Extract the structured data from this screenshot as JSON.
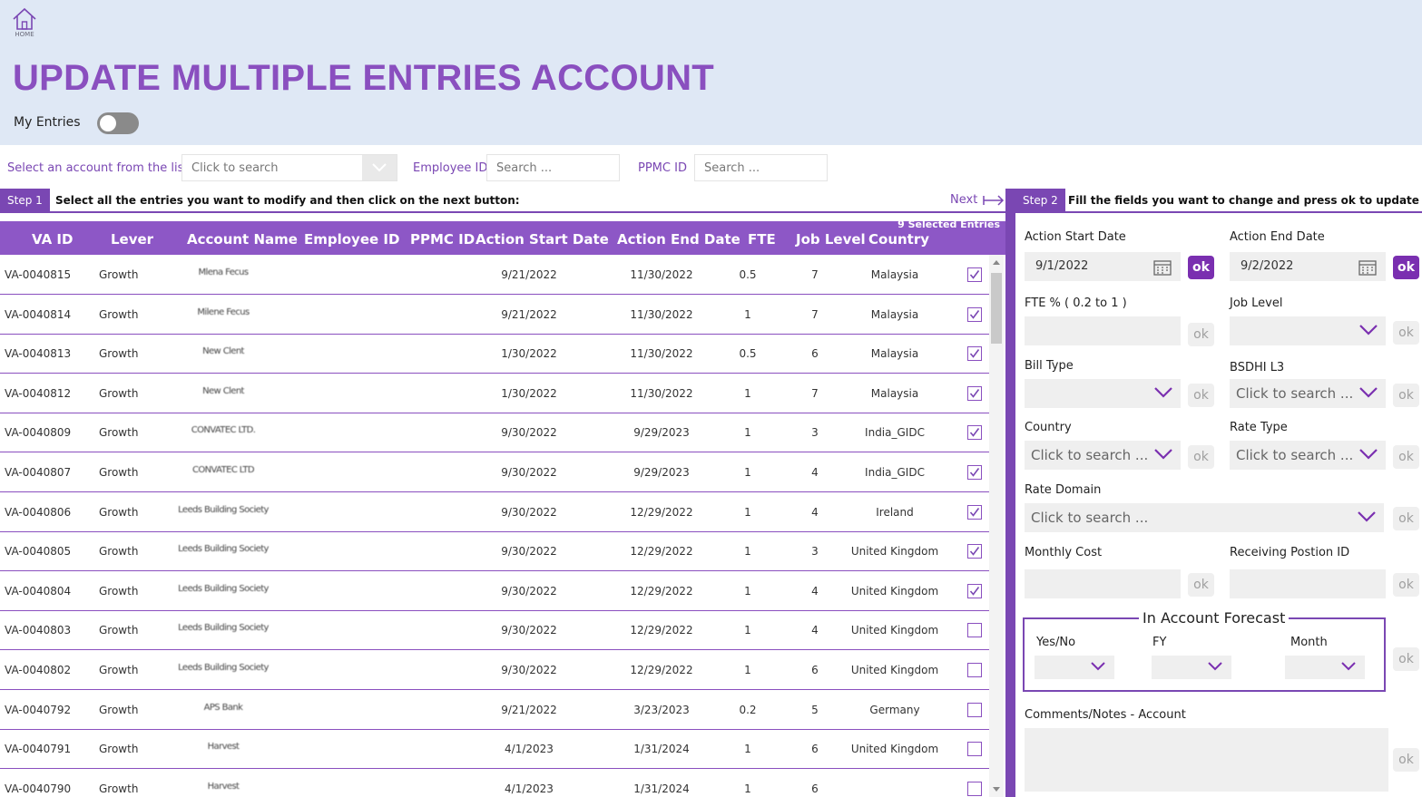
{
  "header": {
    "home_label": "HOME",
    "title": "UPDATE MULTIPLE ENTRIES ACCOUNT",
    "my_entries_label": "My Entries",
    "my_entries_on": false
  },
  "filters": {
    "account_label": "Select an account from the list",
    "account_placeholder": "Click to search",
    "employee_label": "Employee ID",
    "employee_placeholder": "Search ...",
    "ppmc_label": "PPMC ID",
    "ppmc_placeholder": "Search ..."
  },
  "step1": {
    "badge": "Step 1",
    "text": "Select all the entries you want to modify and then click on the next button:",
    "next_label": "Next",
    "selected_count": "9 Selected Entries"
  },
  "table": {
    "columns": [
      "VA ID",
      "Lever",
      "Account Name",
      "Employee ID",
      "PPMC ID",
      "Action Start Date",
      "Action End Date",
      "FTE",
      "Job Level",
      "Country"
    ],
    "rows": [
      {
        "va_id": "VA-0040815",
        "lever": "Growth",
        "account": "Mlena Fecus",
        "start": "9/21/2022",
        "end": "11/30/2022",
        "fte": "0.5",
        "level": "7",
        "country": "Malaysia",
        "checked": true
      },
      {
        "va_id": "VA-0040814",
        "lever": "Growth",
        "account": "Milene Fecus",
        "start": "9/21/2022",
        "end": "11/30/2022",
        "fte": "1",
        "level": "7",
        "country": "Malaysia",
        "checked": true
      },
      {
        "va_id": "VA-0040813",
        "lever": "Growth",
        "account": "New Clent",
        "start": "1/30/2022",
        "end": "11/30/2022",
        "fte": "0.5",
        "level": "6",
        "country": "Malaysia",
        "checked": true
      },
      {
        "va_id": "VA-0040812",
        "lever": "Growth",
        "account": "New Clent",
        "start": "1/30/2022",
        "end": "11/30/2022",
        "fte": "1",
        "level": "7",
        "country": "Malaysia",
        "checked": true
      },
      {
        "va_id": "VA-0040809",
        "lever": "Growth",
        "account": "CONVATEC LTD.",
        "start": "9/30/2022",
        "end": "9/29/2023",
        "fte": "1",
        "level": "3",
        "country": "India_GIDC",
        "checked": true
      },
      {
        "va_id": "VA-0040807",
        "lever": "Growth",
        "account": "CONVATEC LTD",
        "start": "9/30/2022",
        "end": "9/29/2023",
        "fte": "1",
        "level": "4",
        "country": "India_GIDC",
        "checked": true
      },
      {
        "va_id": "VA-0040806",
        "lever": "Growth",
        "account": "Leeds Building Society",
        "start": "9/30/2022",
        "end": "12/29/2022",
        "fte": "1",
        "level": "4",
        "country": "Ireland",
        "checked": true
      },
      {
        "va_id": "VA-0040805",
        "lever": "Growth",
        "account": "Leeds Building Society",
        "start": "9/30/2022",
        "end": "12/29/2022",
        "fte": "1",
        "level": "3",
        "country": "United Kingdom",
        "checked": true
      },
      {
        "va_id": "VA-0040804",
        "lever": "Growth",
        "account": "Leeds Building Society",
        "start": "9/30/2022",
        "end": "12/29/2022",
        "fte": "1",
        "level": "4",
        "country": "United Kingdom",
        "checked": true
      },
      {
        "va_id": "VA-0040803",
        "lever": "Growth",
        "account": "Leeds Building Society",
        "start": "9/30/2022",
        "end": "12/29/2022",
        "fte": "1",
        "level": "4",
        "country": "United Kingdom",
        "checked": false
      },
      {
        "va_id": "VA-0040802",
        "lever": "Growth",
        "account": "Leeds Building Society",
        "start": "9/30/2022",
        "end": "12/29/2022",
        "fte": "1",
        "level": "6",
        "country": "United Kingdom",
        "checked": false
      },
      {
        "va_id": "VA-0040792",
        "lever": "Growth",
        "account": "APS Bank",
        "start": "9/21/2022",
        "end": "3/23/2023",
        "fte": "0.2",
        "level": "5",
        "country": "Germany",
        "checked": false
      },
      {
        "va_id": "VA-0040791",
        "lever": "Growth",
        "account": "Harvest",
        "start": "4/1/2023",
        "end": "1/31/2024",
        "fte": "1",
        "level": "6",
        "country": "United Kingdom",
        "checked": false
      },
      {
        "va_id": "VA-0040790",
        "lever": "Growth",
        "account": "Harvest",
        "start": "4/1/2023",
        "end": "1/31/2024",
        "fte": "1",
        "level": "6",
        "country": "",
        "checked": false
      }
    ]
  },
  "step2": {
    "badge": "Step 2",
    "text": "Fill the fields you want to change and press ok to update them :",
    "ok_label": "ok",
    "action_start_label": "Action Start Date",
    "action_start_value": "9/1/2022",
    "action_end_label": "Action End Date",
    "action_end_value": "9/2/2022",
    "fte_label": "FTE % ( 0.2 to 1 )",
    "job_level_label": "Job Level",
    "bill_type_label": "Bill Type",
    "bsdhi_label": "BSDHI L3",
    "country_label": "Country",
    "rate_type_label": "Rate Type",
    "rate_domain_label": "Rate Domain",
    "monthly_cost_label": "Monthly Cost",
    "receiving_position_label": "Receiving Postion ID",
    "search_placeholder": "Click to search ...",
    "forecast_title": "In Account Forecast",
    "forecast_yesno_label": "Yes/No",
    "forecast_fy_label": "FY",
    "forecast_month_label": "Month",
    "comments_label": "Comments/Notes - Account"
  },
  "colors": {
    "accent": "#7a47b3",
    "table_header": "#8d57c6",
    "header_bg": "#dfe8f5"
  }
}
